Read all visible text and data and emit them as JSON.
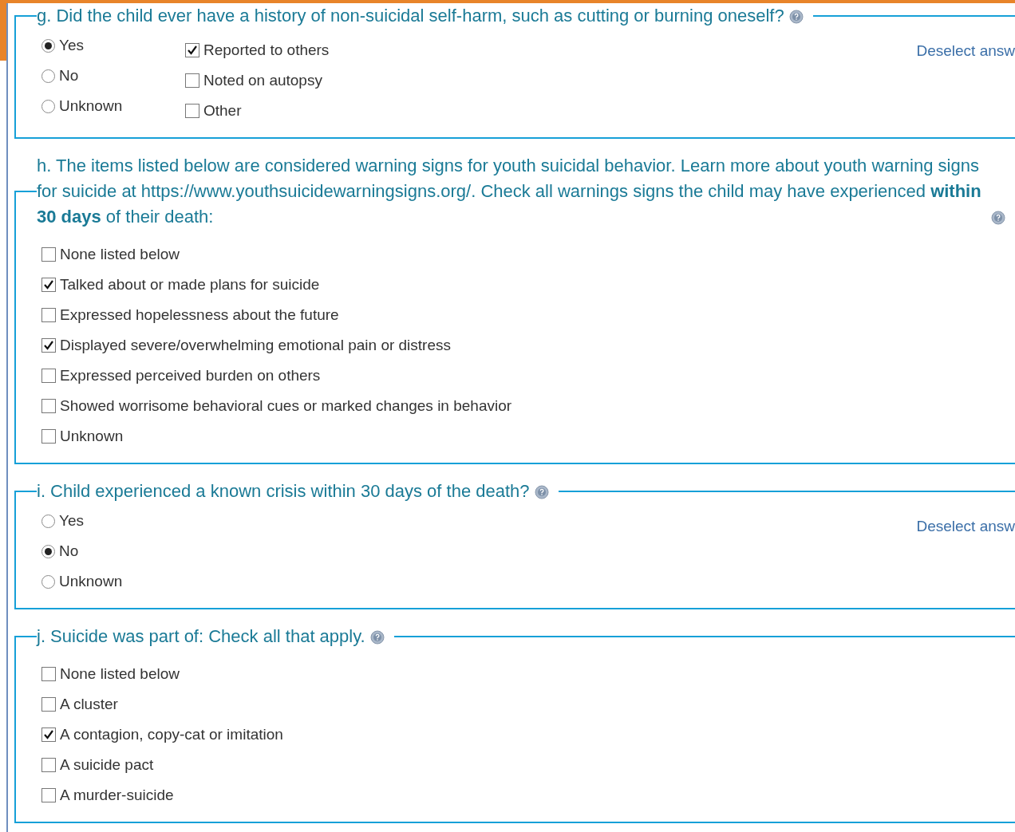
{
  "sections": [
    {
      "kind": "radio_checks",
      "question": "g. Did the child ever have a history of non-suicidal self-harm, such as cutting or burning oneself?",
      "deselect": "Deselect answ",
      "options": [
        {
          "label": "Yes",
          "selected": true
        },
        {
          "label": "No",
          "selected": false
        },
        {
          "label": "Unknown",
          "selected": false
        }
      ],
      "checks": [
        {
          "label": "Reported to others",
          "checked": true
        },
        {
          "label": "Noted on autopsy",
          "checked": false
        },
        {
          "label": "Other",
          "checked": false
        }
      ]
    },
    {
      "kind": "checklist",
      "question": "h. The items listed below are considered warning signs for youth suicidal behavior. Learn more about youth warning signs for suicide at https://www.youthsuicidewarningsigns.org/. Check all warnings signs the child may have experienced **within 30 days** of their death:",
      "checks": [
        {
          "label": "None listed below",
          "checked": false
        },
        {
          "label": "Talked about or made plans for suicide",
          "checked": true
        },
        {
          "label": "Expressed hopelessness about the future",
          "checked": false
        },
        {
          "label": "Displayed severe/overwhelming emotional pain or distress",
          "checked": true
        },
        {
          "label": "Expressed perceived burden on others",
          "checked": false
        },
        {
          "label": "Showed worrisome behavioral cues or marked changes in behavior",
          "checked": false
        },
        {
          "label": "Unknown",
          "checked": false
        }
      ]
    },
    {
      "kind": "radio",
      "question": "i. Child experienced a known crisis within 30 days of the death?",
      "deselect": "Deselect answ",
      "options": [
        {
          "label": "Yes",
          "selected": false
        },
        {
          "label": "No",
          "selected": true
        },
        {
          "label": "Unknown",
          "selected": false
        }
      ]
    },
    {
      "kind": "checklist",
      "question": "j. Suicide was part of: Check all that apply.",
      "checks": [
        {
          "label": "None listed below",
          "checked": false
        },
        {
          "label": "A cluster",
          "checked": false
        },
        {
          "label": "A contagion, copy-cat or imitation",
          "checked": true
        },
        {
          "label": "A suicide pact",
          "checked": false
        },
        {
          "label": "A murder-suicide",
          "checked": false
        }
      ]
    }
  ]
}
